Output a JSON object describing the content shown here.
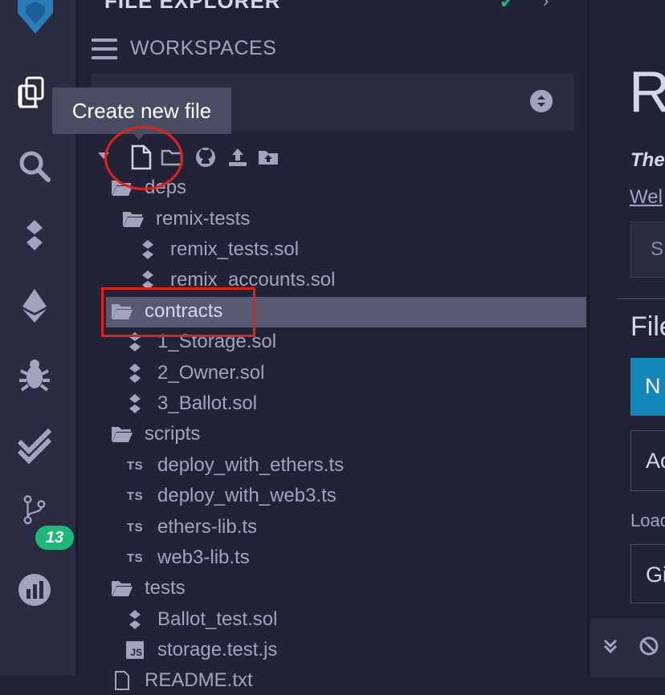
{
  "header": {
    "title": "FILE EXPLORER"
  },
  "sidebar": {
    "badge_count": "13",
    "icons": [
      "remix-logo-icon",
      "file-explorer-icon",
      "search-icon",
      "solidity-compiler-icon",
      "deploy-run-icon",
      "debugger-icon",
      "test-check-icon",
      "git-icon",
      "analytics-icon"
    ]
  },
  "workspaces": {
    "title": "WORKSPACES",
    "tooltip": "Create new file"
  },
  "tree": [
    {
      "label": "deps",
      "type": "folder"
    },
    {
      "label": "remix-tests",
      "type": "folder"
    },
    {
      "label": "remix_tests.sol",
      "type": "sol"
    },
    {
      "label": "remix_accounts.sol",
      "type": "sol"
    },
    {
      "label": "contracts",
      "type": "folder",
      "selected": true
    },
    {
      "label": "1_Storage.sol",
      "type": "sol"
    },
    {
      "label": "2_Owner.sol",
      "type": "sol"
    },
    {
      "label": "3_Ballot.sol",
      "type": "sol"
    },
    {
      "label": "scripts",
      "type": "folder"
    },
    {
      "label": "deploy_with_ethers.ts",
      "type": "ts"
    },
    {
      "label": "deploy_with_web3.ts",
      "type": "ts"
    },
    {
      "label": "ethers-lib.ts",
      "type": "ts"
    },
    {
      "label": "web3-lib.ts",
      "type": "ts"
    },
    {
      "label": "tests",
      "type": "folder"
    },
    {
      "label": "Ballot_test.sol",
      "type": "sol"
    },
    {
      "label": "storage.test.js",
      "type": "js"
    },
    {
      "label": "README.txt",
      "type": "txt"
    }
  ],
  "main": {
    "heading": "R",
    "the_text": "The",
    "welcome_link": "Wel",
    "input_placeholder": "S",
    "files_heading": "File",
    "new_button": "N",
    "add_button": "Ac",
    "load_label": "Load",
    "gist_button": "Gi"
  },
  "colors": {
    "accent": "#1486b8",
    "badge": "#1fb77a",
    "annotation": "#e32118",
    "selected_row": "#585a73"
  }
}
